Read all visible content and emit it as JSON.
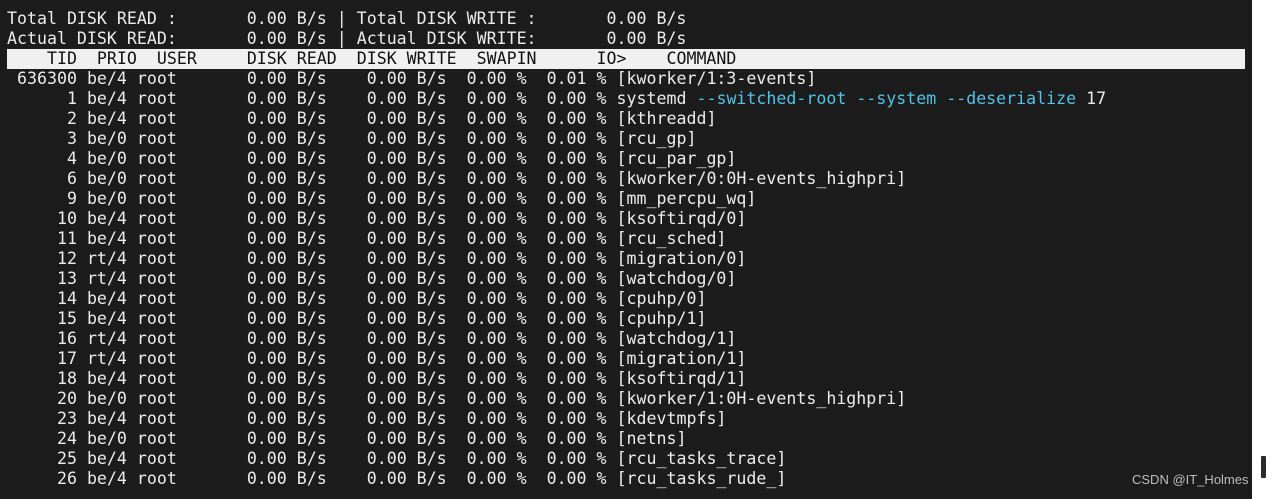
{
  "summary": [
    {
      "label": "Total DISK READ :",
      "read": "0.00 B/s",
      "sep": "|",
      "wlabel": "Total DISK WRITE :",
      "write": "0.00 B/s"
    },
    {
      "label": "Actual DISK READ:",
      "read": "0.00 B/s",
      "sep": "|",
      "wlabel": "Actual DISK WRITE:",
      "write": "0.00 B/s"
    }
  ],
  "columns": [
    "TID",
    "PRIO",
    "USER",
    "DISK READ",
    "DISK WRITE",
    "SWAPIN",
    "IO>",
    "COMMAND"
  ],
  "rows": [
    {
      "tid": "636300",
      "prio": "be/4",
      "user": "root",
      "read": "0.00 B/s",
      "write": "0.00 B/s",
      "swapin": "0.00 %",
      "io": "0.01 %",
      "cmd": "[kworker/1:3-events]",
      "args": ""
    },
    {
      "tid": "1",
      "prio": "be/4",
      "user": "root",
      "read": "0.00 B/s",
      "write": "0.00 B/s",
      "swapin": "0.00 %",
      "io": "0.00 %",
      "cmd": "systemd",
      "args": "--switched-root --system --deserialize",
      "tail": "17"
    },
    {
      "tid": "2",
      "prio": "be/4",
      "user": "root",
      "read": "0.00 B/s",
      "write": "0.00 B/s",
      "swapin": "0.00 %",
      "io": "0.00 %",
      "cmd": "[kthreadd]",
      "args": ""
    },
    {
      "tid": "3",
      "prio": "be/0",
      "user": "root",
      "read": "0.00 B/s",
      "write": "0.00 B/s",
      "swapin": "0.00 %",
      "io": "0.00 %",
      "cmd": "[rcu_gp]",
      "args": ""
    },
    {
      "tid": "4",
      "prio": "be/0",
      "user": "root",
      "read": "0.00 B/s",
      "write": "0.00 B/s",
      "swapin": "0.00 %",
      "io": "0.00 %",
      "cmd": "[rcu_par_gp]",
      "args": ""
    },
    {
      "tid": "6",
      "prio": "be/0",
      "user": "root",
      "read": "0.00 B/s",
      "write": "0.00 B/s",
      "swapin": "0.00 %",
      "io": "0.00 %",
      "cmd": "[kworker/0:0H-events_highpri]",
      "args": ""
    },
    {
      "tid": "9",
      "prio": "be/0",
      "user": "root",
      "read": "0.00 B/s",
      "write": "0.00 B/s",
      "swapin": "0.00 %",
      "io": "0.00 %",
      "cmd": "[mm_percpu_wq]",
      "args": ""
    },
    {
      "tid": "10",
      "prio": "be/4",
      "user": "root",
      "read": "0.00 B/s",
      "write": "0.00 B/s",
      "swapin": "0.00 %",
      "io": "0.00 %",
      "cmd": "[ksoftirqd/0]",
      "args": ""
    },
    {
      "tid": "11",
      "prio": "be/4",
      "user": "root",
      "read": "0.00 B/s",
      "write": "0.00 B/s",
      "swapin": "0.00 %",
      "io": "0.00 %",
      "cmd": "[rcu_sched]",
      "args": ""
    },
    {
      "tid": "12",
      "prio": "rt/4",
      "user": "root",
      "read": "0.00 B/s",
      "write": "0.00 B/s",
      "swapin": "0.00 %",
      "io": "0.00 %",
      "cmd": "[migration/0]",
      "args": ""
    },
    {
      "tid": "13",
      "prio": "rt/4",
      "user": "root",
      "read": "0.00 B/s",
      "write": "0.00 B/s",
      "swapin": "0.00 %",
      "io": "0.00 %",
      "cmd": "[watchdog/0]",
      "args": ""
    },
    {
      "tid": "14",
      "prio": "be/4",
      "user": "root",
      "read": "0.00 B/s",
      "write": "0.00 B/s",
      "swapin": "0.00 %",
      "io": "0.00 %",
      "cmd": "[cpuhp/0]",
      "args": ""
    },
    {
      "tid": "15",
      "prio": "be/4",
      "user": "root",
      "read": "0.00 B/s",
      "write": "0.00 B/s",
      "swapin": "0.00 %",
      "io": "0.00 %",
      "cmd": "[cpuhp/1]",
      "args": ""
    },
    {
      "tid": "16",
      "prio": "rt/4",
      "user": "root",
      "read": "0.00 B/s",
      "write": "0.00 B/s",
      "swapin": "0.00 %",
      "io": "0.00 %",
      "cmd": "[watchdog/1]",
      "args": ""
    },
    {
      "tid": "17",
      "prio": "rt/4",
      "user": "root",
      "read": "0.00 B/s",
      "write": "0.00 B/s",
      "swapin": "0.00 %",
      "io": "0.00 %",
      "cmd": "[migration/1]",
      "args": ""
    },
    {
      "tid": "18",
      "prio": "be/4",
      "user": "root",
      "read": "0.00 B/s",
      "write": "0.00 B/s",
      "swapin": "0.00 %",
      "io": "0.00 %",
      "cmd": "[ksoftirqd/1]",
      "args": ""
    },
    {
      "tid": "20",
      "prio": "be/0",
      "user": "root",
      "read": "0.00 B/s",
      "write": "0.00 B/s",
      "swapin": "0.00 %",
      "io": "0.00 %",
      "cmd": "[kworker/1:0H-events_highpri]",
      "args": ""
    },
    {
      "tid": "23",
      "prio": "be/4",
      "user": "root",
      "read": "0.00 B/s",
      "write": "0.00 B/s",
      "swapin": "0.00 %",
      "io": "0.00 %",
      "cmd": "[kdevtmpfs]",
      "args": ""
    },
    {
      "tid": "24",
      "prio": "be/0",
      "user": "root",
      "read": "0.00 B/s",
      "write": "0.00 B/s",
      "swapin": "0.00 %",
      "io": "0.00 %",
      "cmd": "[netns]",
      "args": ""
    },
    {
      "tid": "25",
      "prio": "be/4",
      "user": "root",
      "read": "0.00 B/s",
      "write": "0.00 B/s",
      "swapin": "0.00 %",
      "io": "0.00 %",
      "cmd": "[rcu_tasks_trace]",
      "args": ""
    },
    {
      "tid": "26",
      "prio": "be/4",
      "user": "root",
      "read": "0.00 B/s",
      "write": "0.00 B/s",
      "swapin": "0.00 %",
      "io": "0.00 %",
      "cmd": "[rcu_tasks_rude_]",
      "args": ""
    }
  ],
  "watermark": "CSDN @IT_Holmes",
  "colors": {
    "background": "#1c1c1c",
    "text": "#ececec",
    "header_bg": "#f0f0f0",
    "arg_highlight": "#4fc3e8"
  }
}
